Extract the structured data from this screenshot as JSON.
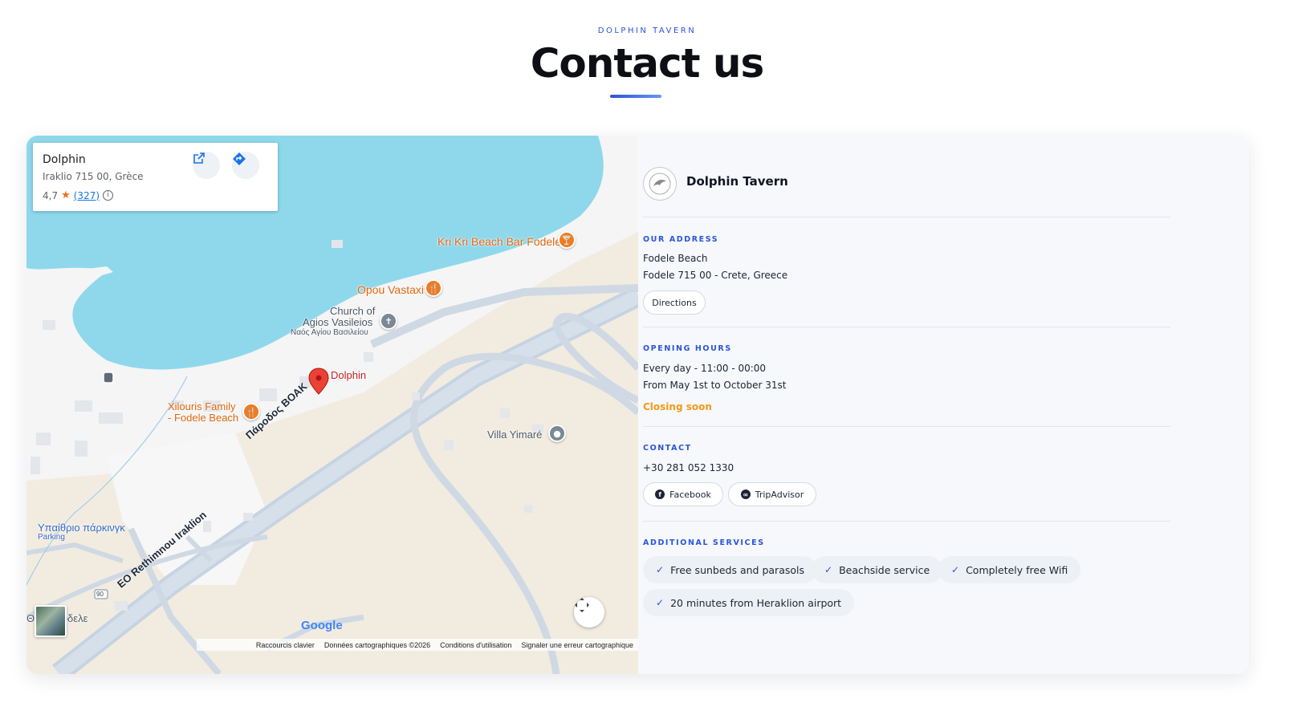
{
  "header": {
    "eyebrow": "DOLPHIN TAVERN",
    "title": "Contact us"
  },
  "map": {
    "info": {
      "name": "Dolphin",
      "address": "Iraklio 715 00, Grèce",
      "rating": "4,7",
      "reviews": "(327)",
      "info_glyph": "i"
    },
    "labels": {
      "kri_kri": "Kri Kri Beach Bar Fodele",
      "opou": "Opou Vastaxi",
      "church_1": "Church of",
      "church_2": "Agios Vasileios",
      "church_greek": "Ναός Αγίου Βασιλείου",
      "dolphin": "Dolphin",
      "xilouris_1": "Xilouris Family",
      "xilouris_2": "- Fodele Beach",
      "villa": "Villa Yimaré",
      "road_1": "Πάροδος ΒΟΑΚ",
      "road_2": "EO Rethimnou Iraklion",
      "parking_1": "Υπαίθριο πάρκινγκ",
      "parking_2": "Parking",
      "village": "Θρ   ξι Φοδελε",
      "route_no": "90"
    },
    "google": "Google",
    "footer": {
      "shortcuts": "Raccourcis clavier",
      "map_data": "Données cartographiques ©2026",
      "terms": "Conditions d'utilisation",
      "report": "Signaler une erreur cartographique"
    },
    "colors": {
      "water": "#8fd8ec",
      "land": "#f2ece0",
      "beach": "#f4f4f4",
      "road": "#c6d3e2",
      "pin": "#ea4335",
      "poi_orange": "#ef7b22"
    }
  },
  "details": {
    "brand": "Dolphin Tavern",
    "address": {
      "title": "OUR ADDRESS",
      "line1": "Fodele Beach",
      "line2": "Fodele 715 00 - Crete, Greece",
      "button": "Directions"
    },
    "hours": {
      "title": "OPENING HOURS",
      "line1": "Every day - 11:00 - 00:00",
      "line2": "From May 1st to October 31st",
      "status": "Closing soon"
    },
    "contact": {
      "title": "CONTACT",
      "phone": "+30 281 052 1330",
      "facebook": "Facebook",
      "tripadvisor": "TripAdvisor"
    },
    "services": {
      "title": "ADDITIONAL SERVICES",
      "items": [
        "Free sunbeds and parasols",
        "Beachside service",
        "Completely free Wifi",
        "20 minutes from Heraklion airport"
      ]
    }
  }
}
